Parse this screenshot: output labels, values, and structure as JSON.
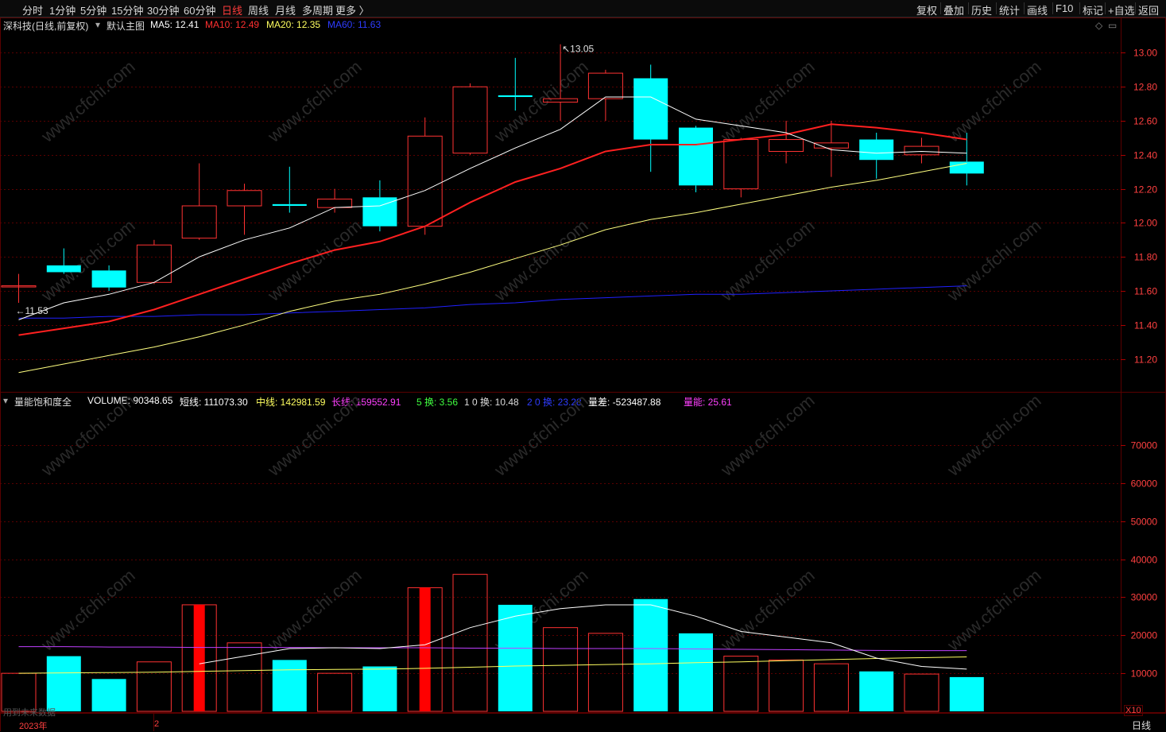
{
  "toolbar": {
    "periods": [
      "分时",
      "1分钟",
      "5分钟",
      "15分钟",
      "30分钟",
      "60分钟",
      "日线",
      "周线",
      "月线",
      "多周期",
      "更多 〉"
    ],
    "active_period": "日线",
    "actions": [
      "复权",
      "叠加",
      "历史",
      "统计",
      "画线",
      "F10",
      "标记",
      "+自选",
      "返回"
    ]
  },
  "main_info": {
    "stock": "深科技(日线,前复权)",
    "indicator": "默认主图",
    "ma5": "MA5: 12.41",
    "ma10": "MA10: 12.49",
    "ma20": "MA20: 12.35",
    "ma60": "MA60: 11.63"
  },
  "sub_info": {
    "indicator": "量能饱和度全",
    "volume": "VOLUME: 90348.65",
    "short": "短线: 111073.30",
    "mid": "中线: 142981.59",
    "long": "长线: 159552.91",
    "turn5": "5 换: 3.56",
    "turn10": "1 0 换: 10.48",
    "turn20": "2 0 换: 23.28",
    "diff": "量差: -523487.88",
    "energy": "量能: 25.61"
  },
  "price_axis": [
    "13.00",
    "12.80",
    "12.60",
    "12.40",
    "12.20",
    "12.00",
    "11.80",
    "11.60",
    "11.40",
    "11.20"
  ],
  "volume_axis": [
    "70000",
    "60000",
    "50000",
    "40000",
    "30000",
    "20000",
    "10000"
  ],
  "annotations": {
    "high": "13.05",
    "low": "11.53"
  },
  "footer": {
    "year": "2023年",
    "month": "2",
    "mult": "X10",
    "period": "日线",
    "watermark_text": "www.cfchi.com",
    "note": "用到未来数据"
  },
  "colors": {
    "up": "#ff3232",
    "down": "#00ffff",
    "ma5": "#ffffff",
    "ma10": "#ff2020",
    "ma20": "#ffff80",
    "ma60": "#2020ff",
    "grid": "#5a0000"
  },
  "chart_data": {
    "type": "candlestick",
    "price_range": [
      11.1,
      13.1
    ],
    "volume_range": [
      0,
      80000
    ],
    "candles": [
      {
        "o": 11.63,
        "h": 11.7,
        "l": 11.53,
        "c": 11.63,
        "v": 10000
      },
      {
        "o": 11.75,
        "h": 11.85,
        "l": 11.7,
        "c": 11.71,
        "v": 14500
      },
      {
        "o": 11.72,
        "h": 11.75,
        "l": 11.6,
        "c": 11.62,
        "v": 8500
      },
      {
        "o": 11.65,
        "h": 11.9,
        "l": 11.64,
        "c": 11.87,
        "v": 13000
      },
      {
        "o": 11.91,
        "h": 12.35,
        "l": 11.9,
        "c": 12.1,
        "v": 28000
      },
      {
        "o": 12.1,
        "h": 12.23,
        "l": 11.93,
        "c": 12.19,
        "v": 18000
      },
      {
        "o": 12.11,
        "h": 12.33,
        "l": 12.06,
        "c": 12.1,
        "v": 13500
      },
      {
        "o": 12.09,
        "h": 12.2,
        "l": 12.06,
        "c": 12.14,
        "v": 10000
      },
      {
        "o": 12.15,
        "h": 12.25,
        "l": 11.95,
        "c": 11.98,
        "v": 11800
      },
      {
        "o": 11.98,
        "h": 12.62,
        "l": 11.93,
        "c": 12.51,
        "v": 32500
      },
      {
        "o": 12.41,
        "h": 12.82,
        "l": 12.4,
        "c": 12.8,
        "v": 36000
      },
      {
        "o": 12.75,
        "h": 12.97,
        "l": 12.66,
        "c": 12.74,
        "v": 28000
      },
      {
        "o": 12.71,
        "h": 13.05,
        "l": 12.6,
        "c": 12.73,
        "v": 22000
      },
      {
        "o": 12.73,
        "h": 12.9,
        "l": 12.6,
        "c": 12.88,
        "v": 20500
      },
      {
        "o": 12.85,
        "h": 12.93,
        "l": 12.3,
        "c": 12.49,
        "v": 29500
      },
      {
        "o": 12.56,
        "h": 12.57,
        "l": 12.18,
        "c": 12.22,
        "v": 20500
      },
      {
        "o": 12.2,
        "h": 12.5,
        "l": 12.15,
        "c": 12.49,
        "v": 14500
      },
      {
        "o": 12.42,
        "h": 12.6,
        "l": 12.35,
        "c": 12.49,
        "v": 13500
      },
      {
        "o": 12.44,
        "h": 12.6,
        "l": 12.27,
        "c": 12.47,
        "v": 12500
      },
      {
        "o": 12.49,
        "h": 12.53,
        "l": 12.26,
        "c": 12.37,
        "v": 10500
      },
      {
        "o": 12.4,
        "h": 12.5,
        "l": 12.35,
        "c": 12.45,
        "v": 9800
      },
      {
        "o": 12.36,
        "h": 12.53,
        "l": 12.22,
        "c": 12.29,
        "v": 9000
      }
    ],
    "ma5": [
      11.43,
      11.53,
      11.58,
      11.65,
      11.8,
      11.9,
      11.97,
      12.09,
      12.1,
      12.19,
      12.32,
      12.44,
      12.55,
      12.74,
      12.74,
      12.61,
      12.57,
      12.53,
      12.43,
      12.41,
      12.42,
      12.41
    ],
    "ma10": [
      11.34,
      11.38,
      11.42,
      11.49,
      11.58,
      11.67,
      11.76,
      11.84,
      11.89,
      11.98,
      12.12,
      12.24,
      12.32,
      12.42,
      12.46,
      12.46,
      12.49,
      12.52,
      12.58,
      12.56,
      12.53,
      12.49
    ],
    "ma20": [
      11.12,
      11.17,
      11.22,
      11.27,
      11.33,
      11.4,
      11.48,
      11.54,
      11.58,
      11.64,
      11.71,
      11.79,
      11.87,
      11.96,
      12.02,
      12.06,
      12.11,
      12.16,
      12.21,
      12.25,
      12.3,
      12.35
    ],
    "ma60": [
      11.44,
      11.44,
      11.45,
      11.45,
      11.46,
      11.46,
      11.47,
      11.48,
      11.49,
      11.5,
      11.52,
      11.53,
      11.55,
      11.56,
      11.57,
      11.58,
      11.58,
      11.59,
      11.6,
      11.61,
      11.62,
      11.63
    ],
    "vol_short": [
      null,
      null,
      null,
      null,
      12500,
      14500,
      16500,
      16700,
      16500,
      17500,
      22000,
      25000,
      27000,
      28000,
      28000,
      25000,
      21000,
      19500,
      18000,
      14000,
      11800,
      11100
    ],
    "vol_mid": [
      10000,
      10100,
      10200,
      10300,
      10500,
      10700,
      10900,
      11000,
      11100,
      11300,
      11600,
      11900,
      12100,
      12300,
      12500,
      12800,
      13000,
      13300,
      13600,
      13900,
      14100,
      14300
    ],
    "vol_long": [
      17000,
      17000,
      16900,
      16900,
      16800,
      16800,
      16800,
      16700,
      16700,
      16700,
      16600,
      16600,
      16500,
      16500,
      16500,
      16400,
      16300,
      16200,
      16100,
      16000,
      15950,
      15955
    ]
  }
}
